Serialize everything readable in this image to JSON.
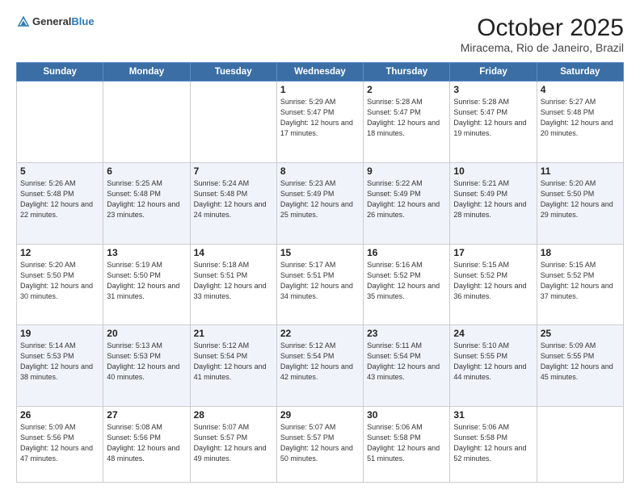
{
  "header": {
    "logo_general": "General",
    "logo_blue": "Blue",
    "month": "October 2025",
    "location": "Miracema, Rio de Janeiro, Brazil"
  },
  "weekdays": [
    "Sunday",
    "Monday",
    "Tuesday",
    "Wednesday",
    "Thursday",
    "Friday",
    "Saturday"
  ],
  "weeks": [
    [
      {
        "day": "",
        "info": ""
      },
      {
        "day": "",
        "info": ""
      },
      {
        "day": "",
        "info": ""
      },
      {
        "day": "1",
        "info": "Sunrise: 5:29 AM\nSunset: 5:47 PM\nDaylight: 12 hours\nand 17 minutes."
      },
      {
        "day": "2",
        "info": "Sunrise: 5:28 AM\nSunset: 5:47 PM\nDaylight: 12 hours\nand 18 minutes."
      },
      {
        "day": "3",
        "info": "Sunrise: 5:28 AM\nSunset: 5:47 PM\nDaylight: 12 hours\nand 19 minutes."
      },
      {
        "day": "4",
        "info": "Sunrise: 5:27 AM\nSunset: 5:48 PM\nDaylight: 12 hours\nand 20 minutes."
      }
    ],
    [
      {
        "day": "5",
        "info": "Sunrise: 5:26 AM\nSunset: 5:48 PM\nDaylight: 12 hours\nand 22 minutes."
      },
      {
        "day": "6",
        "info": "Sunrise: 5:25 AM\nSunset: 5:48 PM\nDaylight: 12 hours\nand 23 minutes."
      },
      {
        "day": "7",
        "info": "Sunrise: 5:24 AM\nSunset: 5:48 PM\nDaylight: 12 hours\nand 24 minutes."
      },
      {
        "day": "8",
        "info": "Sunrise: 5:23 AM\nSunset: 5:49 PM\nDaylight: 12 hours\nand 25 minutes."
      },
      {
        "day": "9",
        "info": "Sunrise: 5:22 AM\nSunset: 5:49 PM\nDaylight: 12 hours\nand 26 minutes."
      },
      {
        "day": "10",
        "info": "Sunrise: 5:21 AM\nSunset: 5:49 PM\nDaylight: 12 hours\nand 28 minutes."
      },
      {
        "day": "11",
        "info": "Sunrise: 5:20 AM\nSunset: 5:50 PM\nDaylight: 12 hours\nand 29 minutes."
      }
    ],
    [
      {
        "day": "12",
        "info": "Sunrise: 5:20 AM\nSunset: 5:50 PM\nDaylight: 12 hours\nand 30 minutes."
      },
      {
        "day": "13",
        "info": "Sunrise: 5:19 AM\nSunset: 5:50 PM\nDaylight: 12 hours\nand 31 minutes."
      },
      {
        "day": "14",
        "info": "Sunrise: 5:18 AM\nSunset: 5:51 PM\nDaylight: 12 hours\nand 33 minutes."
      },
      {
        "day": "15",
        "info": "Sunrise: 5:17 AM\nSunset: 5:51 PM\nDaylight: 12 hours\nand 34 minutes."
      },
      {
        "day": "16",
        "info": "Sunrise: 5:16 AM\nSunset: 5:52 PM\nDaylight: 12 hours\nand 35 minutes."
      },
      {
        "day": "17",
        "info": "Sunrise: 5:15 AM\nSunset: 5:52 PM\nDaylight: 12 hours\nand 36 minutes."
      },
      {
        "day": "18",
        "info": "Sunrise: 5:15 AM\nSunset: 5:52 PM\nDaylight: 12 hours\nand 37 minutes."
      }
    ],
    [
      {
        "day": "19",
        "info": "Sunrise: 5:14 AM\nSunset: 5:53 PM\nDaylight: 12 hours\nand 38 minutes."
      },
      {
        "day": "20",
        "info": "Sunrise: 5:13 AM\nSunset: 5:53 PM\nDaylight: 12 hours\nand 40 minutes."
      },
      {
        "day": "21",
        "info": "Sunrise: 5:12 AM\nSunset: 5:54 PM\nDaylight: 12 hours\nand 41 minutes."
      },
      {
        "day": "22",
        "info": "Sunrise: 5:12 AM\nSunset: 5:54 PM\nDaylight: 12 hours\nand 42 minutes."
      },
      {
        "day": "23",
        "info": "Sunrise: 5:11 AM\nSunset: 5:54 PM\nDaylight: 12 hours\nand 43 minutes."
      },
      {
        "day": "24",
        "info": "Sunrise: 5:10 AM\nSunset: 5:55 PM\nDaylight: 12 hours\nand 44 minutes."
      },
      {
        "day": "25",
        "info": "Sunrise: 5:09 AM\nSunset: 5:55 PM\nDaylight: 12 hours\nand 45 minutes."
      }
    ],
    [
      {
        "day": "26",
        "info": "Sunrise: 5:09 AM\nSunset: 5:56 PM\nDaylight: 12 hours\nand 47 minutes."
      },
      {
        "day": "27",
        "info": "Sunrise: 5:08 AM\nSunset: 5:56 PM\nDaylight: 12 hours\nand 48 minutes."
      },
      {
        "day": "28",
        "info": "Sunrise: 5:07 AM\nSunset: 5:57 PM\nDaylight: 12 hours\nand 49 minutes."
      },
      {
        "day": "29",
        "info": "Sunrise: 5:07 AM\nSunset: 5:57 PM\nDaylight: 12 hours\nand 50 minutes."
      },
      {
        "day": "30",
        "info": "Sunrise: 5:06 AM\nSunset: 5:58 PM\nDaylight: 12 hours\nand 51 minutes."
      },
      {
        "day": "31",
        "info": "Sunrise: 5:06 AM\nSunset: 5:58 PM\nDaylight: 12 hours\nand 52 minutes."
      },
      {
        "day": "",
        "info": ""
      }
    ]
  ]
}
